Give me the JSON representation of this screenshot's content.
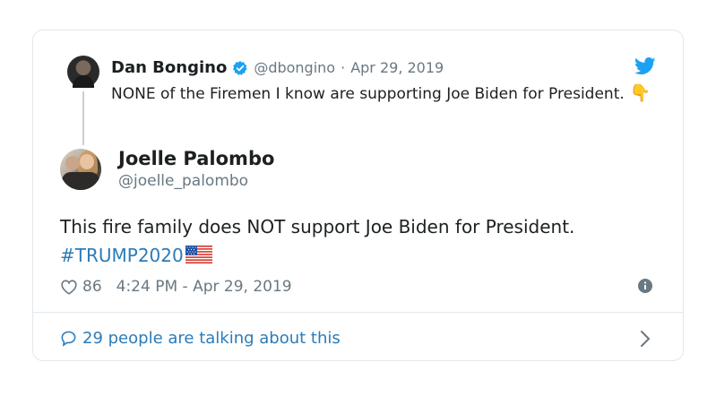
{
  "quoted_tweet": {
    "author_name": "Dan Bongino",
    "handle": "@dbongino",
    "separator": "·",
    "date": "Apr 29, 2019",
    "text": "NONE of the Firemen I know are supporting Joe Biden for President.",
    "emoji_icon": "pointing-down-icon"
  },
  "tweet": {
    "author_name": "Joelle Palombo",
    "handle": "@joelle_palombo",
    "text": "This fire family does NOT support Joe Biden for President.",
    "hashtag": "#TRUMP2020",
    "flag_icon": "us-flag-icon",
    "likes": "86",
    "time": "4:24 PM - Apr 29, 2019"
  },
  "footer": {
    "conversation_label": "29 people are talking about this"
  },
  "colors": {
    "link_blue": "#2b7bb9",
    "text_gray": "#697882",
    "verified_blue": "#1da1f2",
    "border": "#e1e8ed"
  }
}
